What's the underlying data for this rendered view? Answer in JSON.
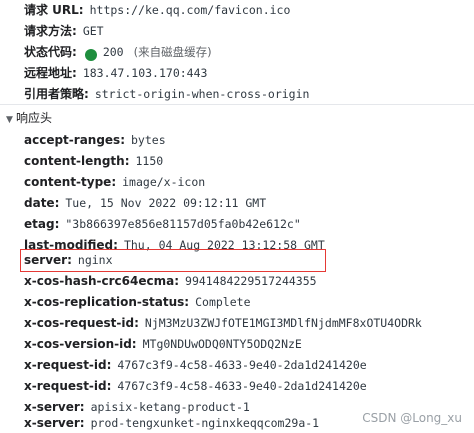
{
  "general": {
    "request_url": {
      "label": "请求 URL:",
      "value": "https://ke.qq.com/favicon.ico"
    },
    "request_method": {
      "label": "请求方法:",
      "value": "GET"
    },
    "status_code": {
      "label": "状态代码:",
      "value": "200",
      "note": "(来自磁盘缓存)",
      "color": "#1e8e3e"
    },
    "remote_address": {
      "label": "远程地址:",
      "value": "183.47.103.170:443"
    },
    "referrer_policy": {
      "label": "引用者策略:",
      "value": "strict-origin-when-cross-origin"
    }
  },
  "response_headers": {
    "title": "响应头",
    "toggle_icon": "triangle-down-icon",
    "items": [
      {
        "key": "accept-ranges:",
        "value": "bytes"
      },
      {
        "key": "content-length:",
        "value": "1150"
      },
      {
        "key": "content-type:",
        "value": "image/x-icon"
      },
      {
        "key": "date:",
        "value": "Tue, 15 Nov 2022 09:12:11 GMT"
      },
      {
        "key": "etag:",
        "value": "\"3b866397e856e81157d05fa0b42e612c\""
      },
      {
        "key": "last-modified:",
        "value": "Thu, 04 Aug 2022 13:12:58 GMT"
      },
      {
        "key": "server:",
        "value": "nginx"
      },
      {
        "key": "x-cos-hash-crc64ecma:",
        "value": "9941484229517244355"
      },
      {
        "key": "x-cos-replication-status:",
        "value": "Complete"
      },
      {
        "key": "x-cos-request-id:",
        "value": "NjM3MzU3ZWJfOTE1MGI3MDlfNjdmMF8xOTU4ODRk"
      },
      {
        "key": "x-cos-version-id:",
        "value": "MTg0NDUwODQ0NTY5ODQ2NzE"
      },
      {
        "key": "x-request-id:",
        "value": "4767c3f9-4c58-4633-9e40-2da1d241420e"
      },
      {
        "key": "x-request-id:",
        "value": "4767c3f9-4c58-4633-9e40-2da1d241420e"
      },
      {
        "key": "x-server:",
        "value": "apisix-ketang-product-1"
      },
      {
        "key": "x-server:",
        "value": "prod-tengxunket-nginxkeqqcom29a-1"
      }
    ]
  },
  "highlight": {
    "color": "#e53935"
  },
  "watermark": "CSDN @Long_xu"
}
